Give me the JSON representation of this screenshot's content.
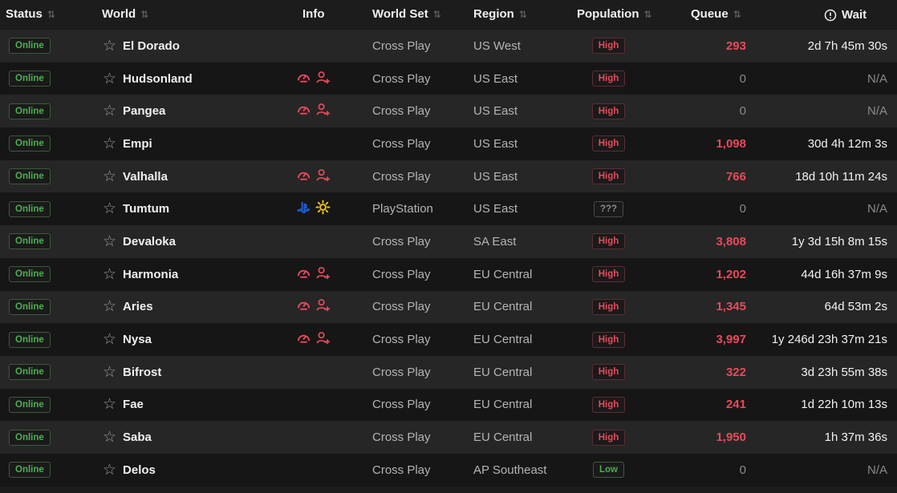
{
  "colors": {
    "accent_red": "#e84a5a",
    "online_green": "#4caf50",
    "playstation_blue": "#1e5fd6",
    "daytime_yellow": "#f0c419"
  },
  "headers": {
    "status": "Status",
    "world": "World",
    "info": "Info",
    "world_set": "World Set",
    "region": "Region",
    "population": "Population",
    "queue": "Queue",
    "wait": "Wait"
  },
  "rows": [
    {
      "status": "Online",
      "world": "El Dorado",
      "icons": [],
      "world_set": "Cross Play",
      "region": "US West",
      "population": "High",
      "pop_class": "high",
      "queue": "293",
      "queue_class": "red",
      "wait": "2d 7h 45m 30s"
    },
    {
      "status": "Online",
      "world": "Hudsonland",
      "icons": [
        "speedometer-icon",
        "add-user-icon"
      ],
      "world_set": "Cross Play",
      "region": "US East",
      "population": "High",
      "pop_class": "high",
      "queue": "0",
      "queue_class": "gray",
      "wait": "N/A"
    },
    {
      "status": "Online",
      "world": "Pangea",
      "icons": [
        "speedometer-icon",
        "add-user-icon"
      ],
      "world_set": "Cross Play",
      "region": "US East",
      "population": "High",
      "pop_class": "high",
      "queue": "0",
      "queue_class": "gray",
      "wait": "N/A"
    },
    {
      "status": "Online",
      "world": "Empi",
      "icons": [],
      "world_set": "Cross Play",
      "region": "US East",
      "population": "High",
      "pop_class": "high",
      "queue": "1,098",
      "queue_class": "red",
      "wait": "30d 4h 12m 3s"
    },
    {
      "status": "Online",
      "world": "Valhalla",
      "icons": [
        "speedometer-icon",
        "add-user-icon"
      ],
      "world_set": "Cross Play",
      "region": "US East",
      "population": "High",
      "pop_class": "high",
      "queue": "766",
      "queue_class": "red",
      "wait": "18d 10h 11m 24s"
    },
    {
      "status": "Online",
      "world": "Tumtum",
      "icons": [
        "playstation-icon",
        "sun-icon"
      ],
      "world_set": "PlayStation",
      "region": "US East",
      "population": "???",
      "pop_class": "unknown",
      "queue": "0",
      "queue_class": "gray",
      "wait": "N/A"
    },
    {
      "status": "Online",
      "world": "Devaloka",
      "icons": [],
      "world_set": "Cross Play",
      "region": "SA East",
      "population": "High",
      "pop_class": "high",
      "queue": "3,808",
      "queue_class": "red",
      "wait": "1y 3d 15h 8m 15s"
    },
    {
      "status": "Online",
      "world": "Harmonia",
      "icons": [
        "speedometer-icon",
        "add-user-icon"
      ],
      "world_set": "Cross Play",
      "region": "EU Central",
      "population": "High",
      "pop_class": "high",
      "queue": "1,202",
      "queue_class": "red",
      "wait": "44d 16h 37m 9s"
    },
    {
      "status": "Online",
      "world": "Aries",
      "icons": [
        "speedometer-icon",
        "add-user-icon"
      ],
      "world_set": "Cross Play",
      "region": "EU Central",
      "population": "High",
      "pop_class": "high",
      "queue": "1,345",
      "queue_class": "red",
      "wait": "64d 53m 2s"
    },
    {
      "status": "Online",
      "world": "Nysa",
      "icons": [
        "speedometer-icon",
        "add-user-icon"
      ],
      "world_set": "Cross Play",
      "region": "EU Central",
      "population": "High",
      "pop_class": "high",
      "queue": "3,997",
      "queue_class": "red",
      "wait": "1y 246d 23h 37m 21s"
    },
    {
      "status": "Online",
      "world": "Bifrost",
      "icons": [],
      "world_set": "Cross Play",
      "region": "EU Central",
      "population": "High",
      "pop_class": "high",
      "queue": "322",
      "queue_class": "red",
      "wait": "3d 23h 55m 38s"
    },
    {
      "status": "Online",
      "world": "Fae",
      "icons": [],
      "world_set": "Cross Play",
      "region": "EU Central",
      "population": "High",
      "pop_class": "high",
      "queue": "241",
      "queue_class": "red",
      "wait": "1d 22h 10m 13s"
    },
    {
      "status": "Online",
      "world": "Saba",
      "icons": [],
      "world_set": "Cross Play",
      "region": "EU Central",
      "population": "High",
      "pop_class": "high",
      "queue": "1,950",
      "queue_class": "red",
      "wait": "1h 37m 36s"
    },
    {
      "status": "Online",
      "world": "Delos",
      "icons": [],
      "world_set": "Cross Play",
      "region": "AP Southeast",
      "population": "Low",
      "pop_class": "low",
      "queue": "0",
      "queue_class": "gray",
      "wait": "N/A"
    }
  ]
}
